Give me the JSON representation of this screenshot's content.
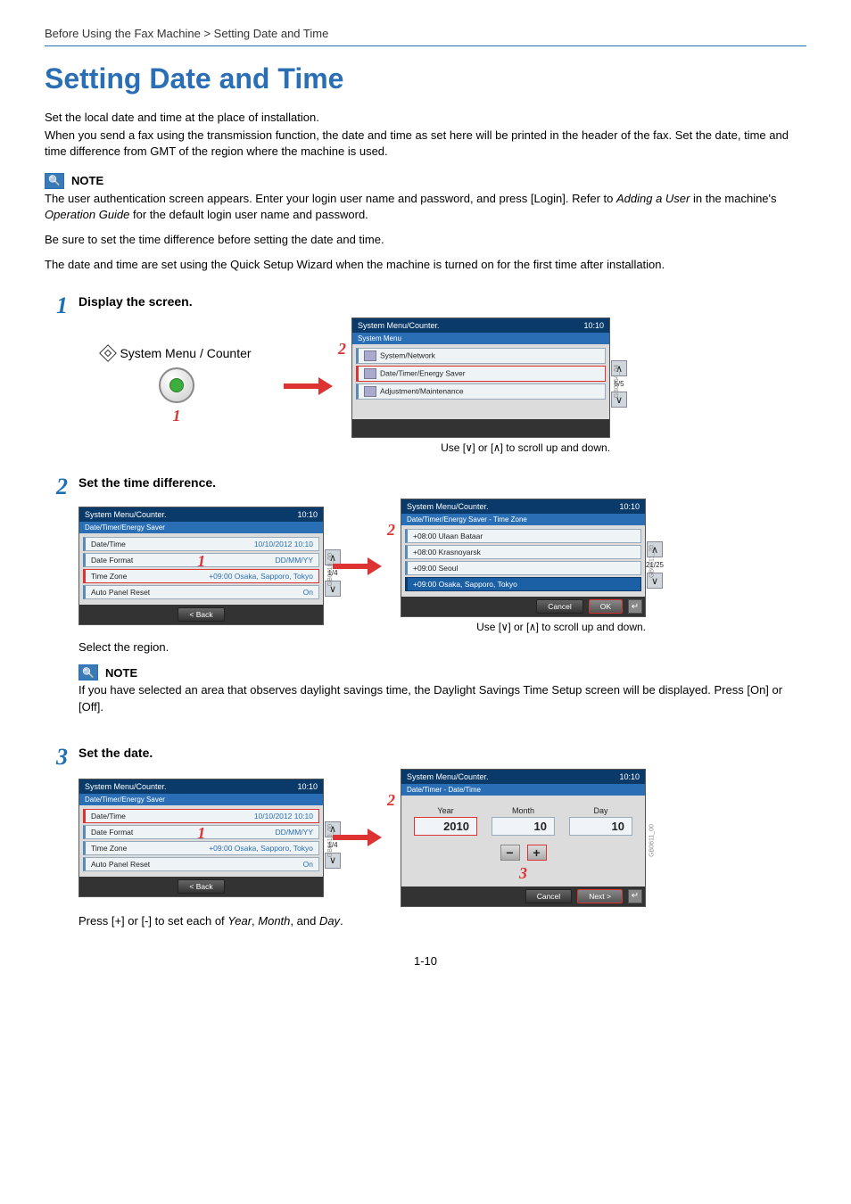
{
  "breadcrumb": "Before Using the Fax Machine > Setting Date and Time",
  "page_title": "Setting Date and Time",
  "intro": {
    "p1": "Set the local date and time at the place of installation.",
    "p2": "When you send a fax using the transmission function, the date and time as set here will be printed in the header of the fax. Set the date, time and time difference from GMT of the region where the machine is used."
  },
  "note_label": "NOTE",
  "note1": {
    "p1a": "The user authentication screen appears. Enter your login user name and password, and press [Login]. Refer to ",
    "p1b": "Adding a User",
    "p1c": " in the machine's ",
    "p1d": "Operation Guide",
    "p1e": " for the default login user name and password.",
    "p2": "Be sure to set the time difference before setting the date and time.",
    "p3": "The date and time are set using the Quick Setup Wizard when the machine is turned on for the first time after installation."
  },
  "steps": {
    "s1": {
      "num": "1",
      "title": "Display the screen.",
      "button_label": "System Menu / Counter",
      "callout1": "1",
      "callout2": "2"
    },
    "s2": {
      "num": "2",
      "title": "Set the time difference.",
      "text": "Select the region.",
      "callout1": "1",
      "callout2": "2"
    },
    "s3": {
      "num": "3",
      "title": "Set the date.",
      "callout1": "1",
      "callout2": "2",
      "callout3": "3"
    }
  },
  "note2": {
    "body": "If you have selected an area that observes daylight savings time, the Daylight Savings Time Setup screen will be displayed. Press [On] or [Off]."
  },
  "step3_text_a": "Press [+] or [-] to set each of ",
  "step3_text_b": "Year",
  "step3_text_c": ", ",
  "step3_text_d": "Month",
  "step3_text_e": ", and ",
  "step3_text_f": "Day",
  "step3_text_g": ".",
  "scroll_caption_a": "Use [",
  "scroll_caption_b": "] or [",
  "scroll_caption_c": "] to scroll up and down.",
  "screen_common": {
    "title": "System Menu/Counter.",
    "clock": "10:10",
    "back": "< Back",
    "cancel": "Cancel",
    "ok": "OK",
    "next": "Next >"
  },
  "screen1b": {
    "sub": "System Menu",
    "items": [
      "System/Network",
      "Date/Timer/Energy Saver",
      "Adjustment/Maintenance"
    ],
    "page": "5/5",
    "ref": "GB0054_04"
  },
  "screen2a": {
    "sub": "Date/Timer/Energy Saver",
    "rows": [
      {
        "label": "Date/Time",
        "val": "10/10/2012 10:10"
      },
      {
        "label": "Date Format",
        "val": "DD/MM/YY"
      },
      {
        "label": "Time Zone",
        "val": "+09:00 Osaka, Sapporo, Tokyo"
      },
      {
        "label": "Auto Panel Reset",
        "val": "On"
      }
    ],
    "page": "1/4",
    "ref": "GB0610_00"
  },
  "screen2b": {
    "sub": "Date/Timer/Energy Saver - Time Zone",
    "rows": [
      "+08:00 Ulaan Bataar",
      "+08:00 Krasnoyarsk",
      "+09:00 Seoul",
      "+09:00 Osaka, Sapporo, Tokyo"
    ],
    "page": "21/25",
    "ref": "GB0611_20"
  },
  "screen3a": {
    "sub": "Date/Timer/Energy Saver",
    "rows": [
      {
        "label": "Date/Time",
        "val": "10/10/2012 10:10"
      },
      {
        "label": "Date Format",
        "val": "DD/MM/YY"
      },
      {
        "label": "Time Zone",
        "val": "+09:00 Osaka, Sapporo, Tokyo"
      },
      {
        "label": "Auto Panel Reset",
        "val": "On"
      }
    ],
    "page": "1/4",
    "ref": "GB0610_00"
  },
  "screen3b": {
    "sub": "Date/Timer - Date/Time",
    "year_label": "Year",
    "month_label": "Month",
    "day_label": "Day",
    "year": "2010",
    "month": "10",
    "day": "10",
    "ref": "GB0611_00"
  },
  "page_number": "1-10"
}
